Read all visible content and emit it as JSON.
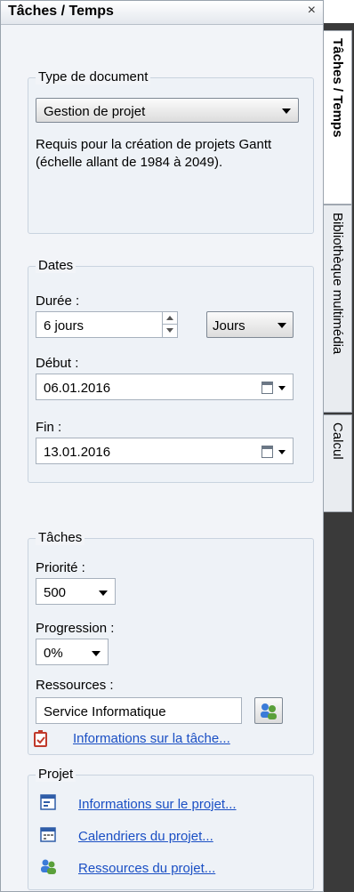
{
  "panel": {
    "title": "Tâches / Temps",
    "close": "×"
  },
  "tabs": [
    {
      "label": "Tâches / Temps"
    },
    {
      "label": "Bibliothèque multimédia"
    },
    {
      "label": "Calcul"
    }
  ],
  "doc_type": {
    "legend": "Type de document",
    "selected": "Gestion de projet",
    "description_line1": "Requis pour la création de projets Gantt",
    "description_line2": "(échelle allant de 1984 à 2049)."
  },
  "dates": {
    "legend": "Dates",
    "duree_label": "Durée :",
    "duree_value": "6 jours",
    "unit_value": "Jours",
    "debut_label": "Début :",
    "debut_value": "06.01.2016",
    "fin_label": "Fin :",
    "fin_value": "13.01.2016"
  },
  "taches": {
    "legend": "Tâches",
    "priorite_label": "Priorité :",
    "priorite_value": "500",
    "progression_label": "Progression :",
    "progression_value": "0%",
    "ressources_label": "Ressources :",
    "ressources_value": "Service Informatique",
    "info_link": "Informations sur la tâche..."
  },
  "projet": {
    "legend": "Projet",
    "links": [
      "Informations sur le projet...",
      "Calendriers du projet...",
      "Ressources du projet..."
    ]
  }
}
